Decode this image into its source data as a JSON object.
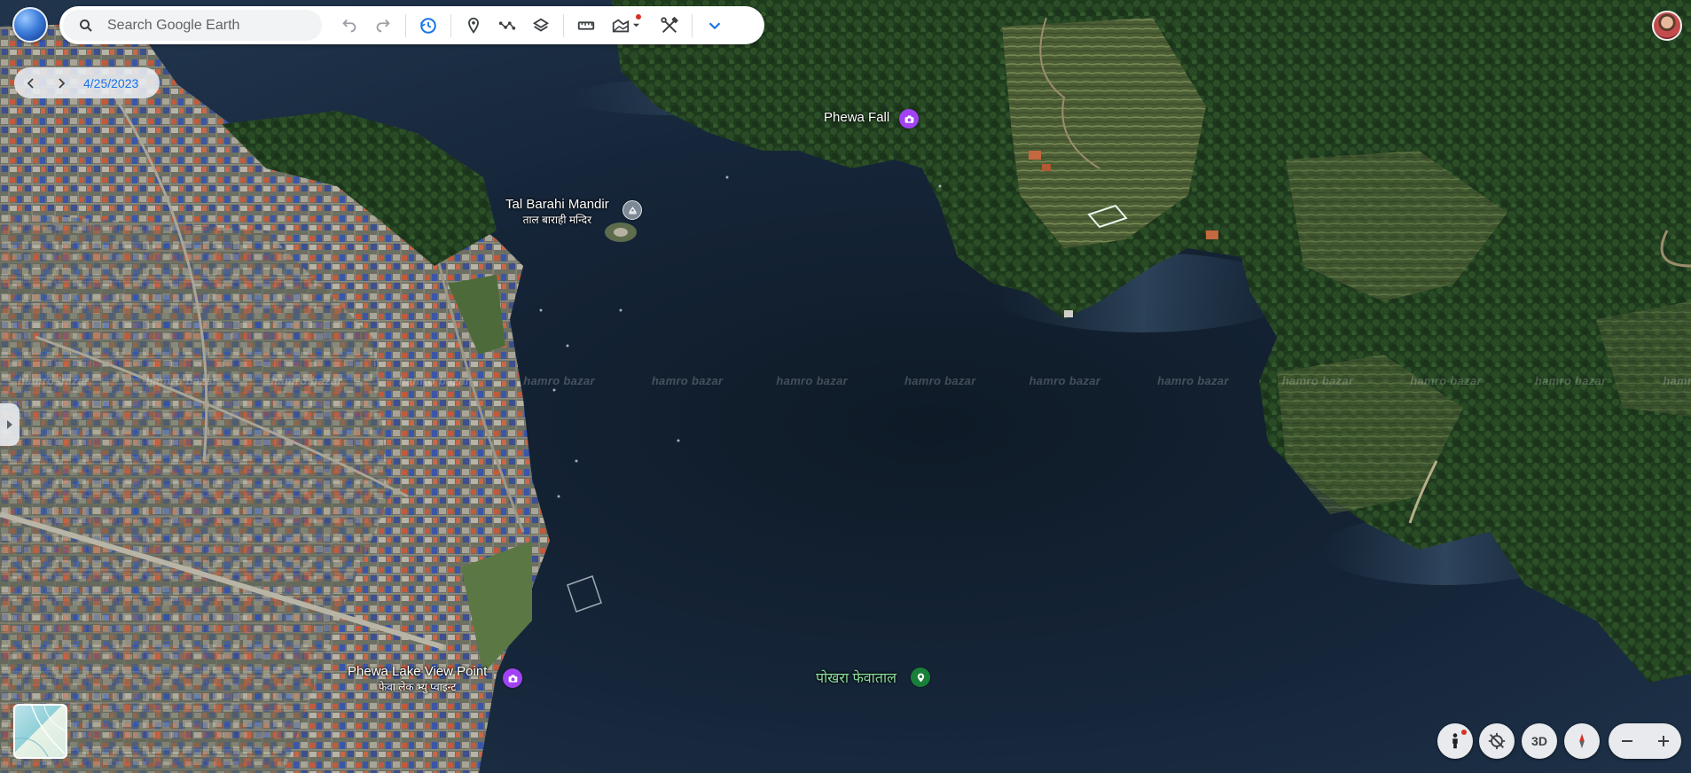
{
  "search": {
    "placeholder": "Search Google Earth"
  },
  "timeline": {
    "date": "4/25/2023"
  },
  "places": {
    "phewa_fall": {
      "name": "Phewa Fall"
    },
    "tal_barahi": {
      "name": "Tal Barahi Mandir",
      "sub": "ताल बाराही मन्दिर"
    },
    "view_point": {
      "name": "Phewa Lake View Point",
      "sub": "फेवा लेक भ्यु प्वाइन्ट"
    },
    "phewa_lake": {
      "name": "पोखरा फेवाताल"
    }
  },
  "watermark": {
    "text": "hamro bazar"
  },
  "controls": {
    "three_d_label": "3D"
  },
  "colors": {
    "accent": "#1a73e8",
    "photo_pin": "#a142f4",
    "lake_pin": "#188038",
    "lake_label": "#8bdc9b",
    "notification_dot": "#d93025"
  },
  "icons": {
    "search": "search-icon",
    "undo": "undo-icon",
    "redo": "redo-icon",
    "history": "historical-imagery-icon",
    "placemark": "placemark-icon",
    "path": "path-icon",
    "layers": "layers-icon",
    "measure": "ruler-icon",
    "map_style": "map-style-icon",
    "tools": "tools-icon",
    "more": "chevron-down-icon",
    "pegman": "pegman-icon",
    "recenter": "gps-off-icon",
    "compass": "compass-icon",
    "zoom_out": "minus-icon",
    "zoom_in": "plus-icon"
  }
}
